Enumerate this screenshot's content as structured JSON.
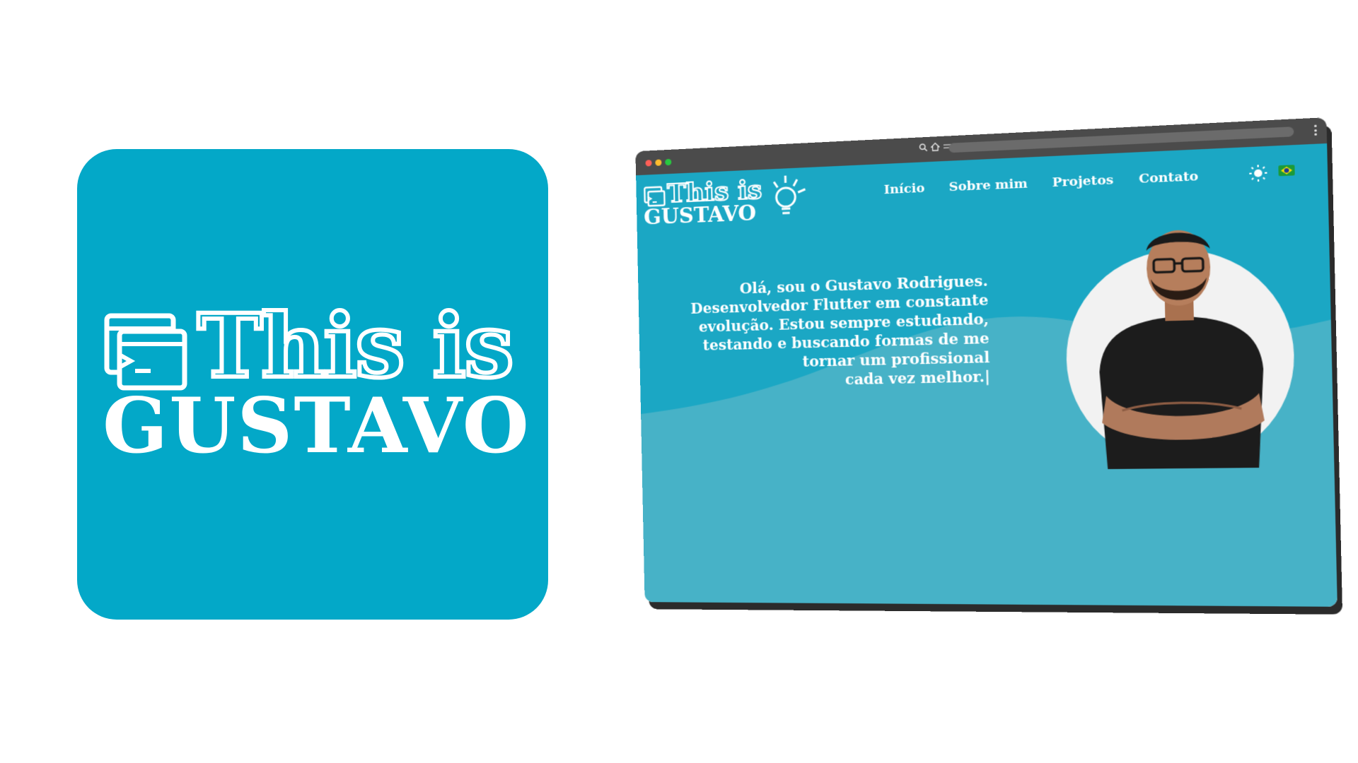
{
  "logo": {
    "line1": "This is",
    "line2": "GUSTAVO"
  },
  "browser": {
    "site": {
      "logo_line1": "This is",
      "logo_line2": "GUSTAVO",
      "nav": [
        "Início",
        "Sobre mim",
        "Projetos",
        "Contato"
      ],
      "intro_lines": [
        "Olá, sou o Gustavo Rodrigues.",
        "Desenvolvedor Flutter em constante",
        "evolução. Estou sempre estudando,",
        "testando e buscando formas de me",
        "tornar um profissional",
        "cada vez melhor.|"
      ],
      "icons": [
        "terminal-icon",
        "lightbulb-icon",
        "sun-icon",
        "brazil-flag-icon"
      ]
    },
    "chrome_icons": [
      "search-icon",
      "home-icon",
      "settings-icon",
      "menu-icon"
    ]
  },
  "colors": {
    "card": "#03a8c8",
    "site_bg": "#47b2c7",
    "browser_chrome": "#4b4b4b",
    "text": "#ffffff"
  }
}
